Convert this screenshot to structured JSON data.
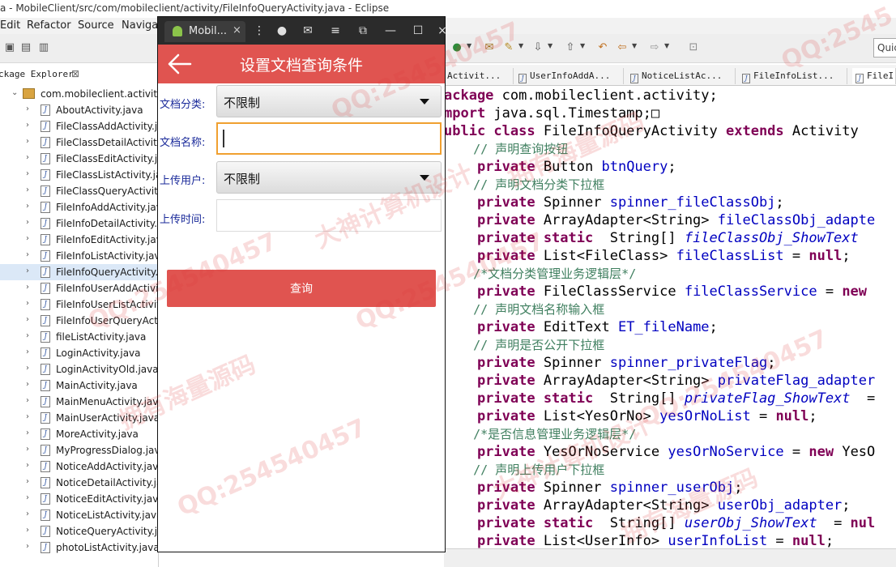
{
  "eclipse": {
    "title": "a - MobileClient/src/com/mobileclient/activity/FileInfoQueryActivity.java - Eclipse",
    "menu": [
      "Edit",
      "Refactor",
      "Source",
      "Navigat"
    ],
    "quick_access": "Quic",
    "package_explorer": {
      "title": "ckage Explorer",
      "close": "⊠",
      "package": "com.mobileclient.activity",
      "files": [
        "AboutActivity.java",
        "FileClassAddActivity.ja",
        "FileClassDetailActivity.",
        "FileClassEditActivity.jav",
        "FileClassListActivity.jav",
        "FileClassQueryActivity.",
        "FileInfoAddActivity.jav",
        "FileInfoDetailActivity.ja",
        "FileInfoEditActivity.jav",
        "FileInfoListActivity.java",
        "FileInfoQueryActivity.ja",
        "FileInfoUserAddActivit",
        "FileInfoUserListActivity",
        "FileInfoUserQueryActi",
        "fileListActivity.java",
        "LoginActivity.java",
        "LoginActivityOld.java",
        "MainActivity.java",
        "MainMenuActivity.java",
        "MainUserActivity.java",
        "MoreActivity.java",
        "MyProgressDialog.jav",
        "NoticeAddActivity.java",
        "NoticeDetailActivity.jav",
        "NoticeEditActivity.java",
        "NoticeListActivity.java",
        "NoticeQueryActivity.ja",
        "photoListActivity.java"
      ],
      "selected_file": "FileInfoQueryActivity.ja"
    },
    "editor_tabs": [
      "Activit...",
      "UserInfoAddA...",
      "NoticeListAc...",
      "FileInfoList...",
      "FileI"
    ],
    "code_lines": [
      {
        "parts": [
          {
            "t": "ackage ",
            "c": "kw"
          },
          {
            "t": "com.mobileclient.activity;",
            "c": ""
          }
        ]
      },
      {
        "parts": [
          {
            "t": "mport ",
            "c": "kw"
          },
          {
            "t": "java.sql.Timestamp;□",
            "c": ""
          }
        ]
      },
      {
        "parts": [
          {
            "t": "ublic class ",
            "c": "kw"
          },
          {
            "t": "FileInfoQueryActivity ",
            "c": ""
          },
          {
            "t": "extends ",
            "c": "kw"
          },
          {
            "t": "Activity",
            "c": ""
          }
        ]
      },
      {
        "parts": [
          {
            "t": "    // 声明查询按钮",
            "c": "cm"
          }
        ]
      },
      {
        "parts": [
          {
            "t": "    private ",
            "c": "kw"
          },
          {
            "t": "Button ",
            "c": ""
          },
          {
            "t": "btnQuery",
            "c": "fld"
          },
          {
            "t": ";",
            "c": ""
          }
        ]
      },
      {
        "parts": [
          {
            "t": "    // 声明文档分类下拉框",
            "c": "cm"
          }
        ]
      },
      {
        "parts": [
          {
            "t": "    private ",
            "c": "kw"
          },
          {
            "t": "Spinner ",
            "c": ""
          },
          {
            "t": "spinner_fileClassObj",
            "c": "fld"
          },
          {
            "t": ";",
            "c": ""
          }
        ]
      },
      {
        "parts": [
          {
            "t": "    private ",
            "c": "kw"
          },
          {
            "t": "ArrayAdapter<String> ",
            "c": ""
          },
          {
            "t": "fileClassObj_adapte",
            "c": "fld"
          }
        ]
      },
      {
        "parts": [
          {
            "t": "    private static ",
            "c": "kw"
          },
          {
            "t": " String[] ",
            "c": ""
          },
          {
            "t": "fileClassObj_ShowText",
            "c": "it"
          }
        ]
      },
      {
        "parts": [
          {
            "t": "    private ",
            "c": "kw"
          },
          {
            "t": "List<FileClass> ",
            "c": ""
          },
          {
            "t": "fileClassList",
            "c": "fld"
          },
          {
            "t": " = ",
            "c": ""
          },
          {
            "t": "null",
            "c": "kw"
          },
          {
            "t": ";",
            "c": ""
          }
        ]
      },
      {
        "parts": [
          {
            "t": "    /*文档分类管理业务逻辑层*/",
            "c": "cm"
          }
        ]
      },
      {
        "parts": [
          {
            "t": "    private ",
            "c": "kw"
          },
          {
            "t": "FileClassService ",
            "c": ""
          },
          {
            "t": "fileClassService",
            "c": "fld"
          },
          {
            "t": " = ",
            "c": ""
          },
          {
            "t": "new",
            "c": "kw"
          }
        ]
      },
      {
        "parts": [
          {
            "t": "    // 声明文档名称输入框",
            "c": "cm"
          }
        ]
      },
      {
        "parts": [
          {
            "t": "    private ",
            "c": "kw"
          },
          {
            "t": "EditText ",
            "c": ""
          },
          {
            "t": "ET_fileName",
            "c": "fld"
          },
          {
            "t": ";",
            "c": ""
          }
        ]
      },
      {
        "parts": [
          {
            "t": "    // 声明是否公开下拉框",
            "c": "cm"
          }
        ]
      },
      {
        "parts": [
          {
            "t": "    private ",
            "c": "kw"
          },
          {
            "t": "Spinner ",
            "c": ""
          },
          {
            "t": "spinner_privateFlag",
            "c": "fld"
          },
          {
            "t": ";",
            "c": ""
          }
        ]
      },
      {
        "parts": [
          {
            "t": "    private ",
            "c": "kw"
          },
          {
            "t": "ArrayAdapter<String> ",
            "c": ""
          },
          {
            "t": "privateFlag_adapter",
            "c": "fld"
          }
        ]
      },
      {
        "parts": [
          {
            "t": "    private static ",
            "c": "kw"
          },
          {
            "t": " String[] ",
            "c": ""
          },
          {
            "t": "privateFlag_ShowText",
            "c": "it"
          },
          {
            "t": "  =",
            "c": ""
          }
        ]
      },
      {
        "parts": [
          {
            "t": "    private ",
            "c": "kw"
          },
          {
            "t": "List<YesOrNo> ",
            "c": ""
          },
          {
            "t": "yesOrNoList",
            "c": "fld"
          },
          {
            "t": " = ",
            "c": ""
          },
          {
            "t": "null",
            "c": "kw"
          },
          {
            "t": ";",
            "c": ""
          }
        ]
      },
      {
        "parts": [
          {
            "t": "    /*是否信息管理业务逻辑层*/",
            "c": "cm"
          }
        ]
      },
      {
        "parts": [
          {
            "t": "    private ",
            "c": "kw"
          },
          {
            "t": "YesOrNoService ",
            "c": ""
          },
          {
            "t": "yesOrNoService",
            "c": "fld"
          },
          {
            "t": " = ",
            "c": ""
          },
          {
            "t": "new ",
            "c": "kw"
          },
          {
            "t": "YesO",
            "c": ""
          }
        ]
      },
      {
        "parts": [
          {
            "t": "    // 声明上传用户下拉框",
            "c": "cm"
          }
        ]
      },
      {
        "parts": [
          {
            "t": "    private ",
            "c": "kw"
          },
          {
            "t": "Spinner ",
            "c": ""
          },
          {
            "t": "spinner_userObj",
            "c": "fld"
          },
          {
            "t": ";",
            "c": ""
          }
        ]
      },
      {
        "parts": [
          {
            "t": "    private ",
            "c": "kw"
          },
          {
            "t": "ArrayAdapter<String> ",
            "c": ""
          },
          {
            "t": "userObj_adapter",
            "c": "fld"
          },
          {
            "t": ";",
            "c": ""
          }
        ]
      },
      {
        "parts": [
          {
            "t": "    private static ",
            "c": "kw"
          },
          {
            "t": " String[] ",
            "c": ""
          },
          {
            "t": "userObj_ShowText",
            "c": "it"
          },
          {
            "t": "  = ",
            "c": ""
          },
          {
            "t": "nul",
            "c": "kw"
          }
        ]
      },
      {
        "parts": [
          {
            "t": "    private ",
            "c": "kw"
          },
          {
            "t": "List<UserInfo> ",
            "c": ""
          },
          {
            "t": "userInfoList",
            "c": "fld"
          },
          {
            "t": " = ",
            "c": ""
          },
          {
            "t": "null",
            "c": "kw"
          },
          {
            "t": ";",
            "c": ""
          }
        ]
      }
    ]
  },
  "emulator": {
    "tab_title": "Mobil...",
    "tab_close": "×",
    "app": {
      "title": "设置文档查询条件",
      "fields": {
        "file_class_label": "文档分类:",
        "file_class_value": "不限制",
        "file_name_label": "文档名称:",
        "file_name_value": "",
        "upload_user_label": "上传用户:",
        "upload_user_value": "不限制",
        "upload_time_label": "上传时间:",
        "upload_time_value": ""
      },
      "query_button": "查询"
    }
  },
  "watermarks": [
    "QQ:254540457",
    "拥有海量源码",
    "大神计算机设计",
    "QQ:2545"
  ],
  "colors": {
    "app_bar": "#e05450",
    "focus_border": "#f0a030",
    "keyword": "#7f0055",
    "comment": "#3f7f5f",
    "field": "#0000c0"
  }
}
